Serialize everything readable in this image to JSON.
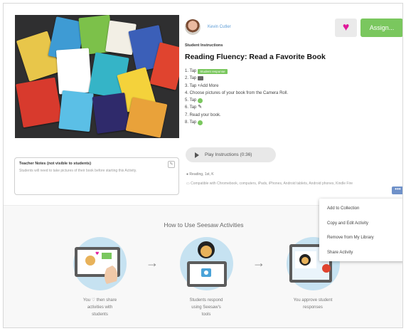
{
  "author": {
    "name": "Kevin Cutler"
  },
  "actions": {
    "assign_label": "Assign..."
  },
  "activity": {
    "section_label": "Student Instructions",
    "title": "Reading Fluency: Read a Favorite Book",
    "steps": [
      {
        "prefix": "1. Tap",
        "after": "",
        "icon": "green-tag",
        "tag_text": "Student response"
      },
      {
        "prefix": "2. Tap",
        "after": "",
        "icon": "drawing-icon"
      },
      {
        "prefix": "3. Tap",
        "after": "+Add More",
        "icon": ""
      },
      {
        "prefix": "4. Choose pictures of your book from the Camera Roll.",
        "after": "",
        "icon": ""
      },
      {
        "prefix": "5. Tap",
        "after": "",
        "icon": "check-icon"
      },
      {
        "prefix": "6. Tap",
        "after": "",
        "icon": "mic-icon"
      },
      {
        "prefix": "7. Read your book.",
        "after": "",
        "icon": ""
      },
      {
        "prefix": "8. Tap",
        "after": "",
        "icon": "check-icon"
      }
    ],
    "play_label": "Play Instructions (0:36)",
    "grade": "Reading, 1st, K",
    "compatibility": "Compatible with Chromebook, computers, iPads, iPhones, Android tablets, Android phones, Kindle Fire"
  },
  "teacher_notes": {
    "title": "Teacher Notes (not visible to students)",
    "body": "Students will need to take pictures of their book before starting this Activity."
  },
  "menu": {
    "items": [
      "Add to Collection",
      "Copy and Edit Activity",
      "Remove from My Library",
      "Share Activity"
    ]
  },
  "how_to": {
    "title": "How to Use Seesaw Activities",
    "steps": [
      {
        "caption1": "You ♡ then share",
        "caption2": "activities with",
        "caption3": "students"
      },
      {
        "caption1": "Students respond",
        "caption2": "using Seesaw's",
        "caption3": "tools"
      },
      {
        "caption1": "You approve student",
        "caption2": "responses",
        "caption3": ""
      }
    ]
  },
  "colors": {
    "accent_green": "#7ac75e",
    "heart_pink": "#e0189a",
    "link_blue": "#5b9bd6"
  }
}
